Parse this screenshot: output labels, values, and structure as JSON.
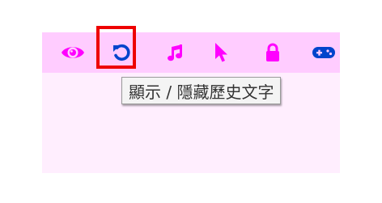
{
  "colors": {
    "toolbar_bg": "#ffccff",
    "panel_bg": "#ffeefe",
    "icon_magenta": "#ff00ff",
    "icon_active_blue": "#0044cc",
    "highlight_red": "#ee0000"
  },
  "toolbar": {
    "buttons": [
      {
        "icon": "eye-icon",
        "active": false
      },
      {
        "icon": "rotate-left-icon",
        "active": true
      },
      {
        "icon": "music-note-icon",
        "active": false
      },
      {
        "icon": "mouse-pointer-icon",
        "active": false
      },
      {
        "icon": "lock-icon",
        "active": false
      },
      {
        "icon": "gamepad-icon",
        "active": false
      }
    ]
  },
  "tooltip": {
    "text": "顯示 / 隱藏歷史文字"
  }
}
